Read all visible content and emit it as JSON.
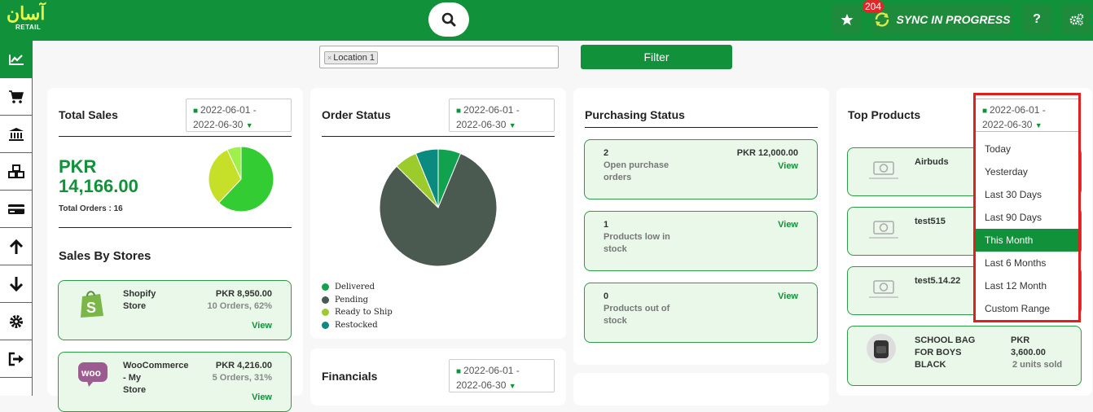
{
  "brand": {
    "logo_ar": "آسان",
    "logo_en": "RETAIL"
  },
  "topbar": {
    "notifications_count": "204",
    "sync_label": "SYNC IN PROGRESS",
    "help_label": "?"
  },
  "filter": {
    "location_tag": "Location 1",
    "tag_remove": "×",
    "button_label": "Filter"
  },
  "total_sales": {
    "title": "Total Sales",
    "date_line1": "2022-06-01 -",
    "date_line2": "2022-06-30",
    "currency": "PKR",
    "amount": "14,166.00",
    "orders_label": "Total Orders : 16"
  },
  "sales_by_stores": {
    "title": "Sales By Stores",
    "stores": [
      {
        "name_line1": "Shopify",
        "name_line2": "Store",
        "amount": "PKR 8,950.00",
        "meta": "10 Orders, 62%",
        "view": "View"
      },
      {
        "name_line1": "WooCommerce",
        "name_line2": "- My",
        "name_line3": "Store",
        "amount": "PKR 4,216.00",
        "meta": "5 Orders, 31%",
        "view": "View"
      }
    ]
  },
  "order_status": {
    "title": "Order Status",
    "date_line1": "2022-06-01 -",
    "date_line2": "2022-06-30",
    "legend": [
      "Delivered",
      "Pending",
      "Ready to Ship",
      "Restocked"
    ]
  },
  "financials": {
    "title": "Financials",
    "date_line1": "2022-06-01 -",
    "date_line2": "2022-06-30"
  },
  "purchasing_status": {
    "title": "Purchasing Status",
    "items": [
      {
        "count": "2",
        "desc": "Open purchase orders",
        "amount": "PKR 12,000.00",
        "view": "View"
      },
      {
        "count": "1",
        "desc": "Products low in stock",
        "view": "View"
      },
      {
        "count": "0",
        "desc": "Products out of stock",
        "view": "View"
      }
    ]
  },
  "top_products": {
    "title": "Top Products",
    "date_line1": "2022-06-01 -",
    "date_line2": "2022-06-30",
    "products": [
      {
        "name": "Airbuds"
      },
      {
        "name": "test515"
      },
      {
        "name": "test5.14.22"
      },
      {
        "name_line1": "SCHOOL BAG",
        "name_line2": "FOR BOYS",
        "name_line3": "BLACK",
        "currency": "PKR",
        "amount": "3,600.00",
        "sold": "2 units sold"
      }
    ]
  },
  "date_dropdown": {
    "options": [
      "Today",
      "Yesterday",
      "Last 30 Days",
      "Last 90 Days",
      "This Month",
      "Last 6 Months",
      "Last 12 Month",
      "Custom Range"
    ],
    "selected": "This Month"
  },
  "chart_data": [
    {
      "type": "pie",
      "title": "",
      "labels": [
        "segment-1",
        "segment-2",
        "segment-3"
      ],
      "values": [
        62,
        31,
        7
      ],
      "colors": [
        "#33cc33",
        "#c6e02a",
        "#9ff04a"
      ]
    },
    {
      "type": "pie",
      "title": "Order Status",
      "labels": [
        "Delivered",
        "Pending",
        "Ready to Ship",
        "Restocked"
      ],
      "values": [
        1,
        13,
        1,
        1
      ],
      "colors": [
        "#11a24f",
        "#4a5a50",
        "#9ccc2c",
        "#0b8a80"
      ]
    }
  ],
  "colors": {
    "brand_green": "#11913a",
    "light_green": "#e9f8e9",
    "highlight_red": "#e0201f"
  }
}
